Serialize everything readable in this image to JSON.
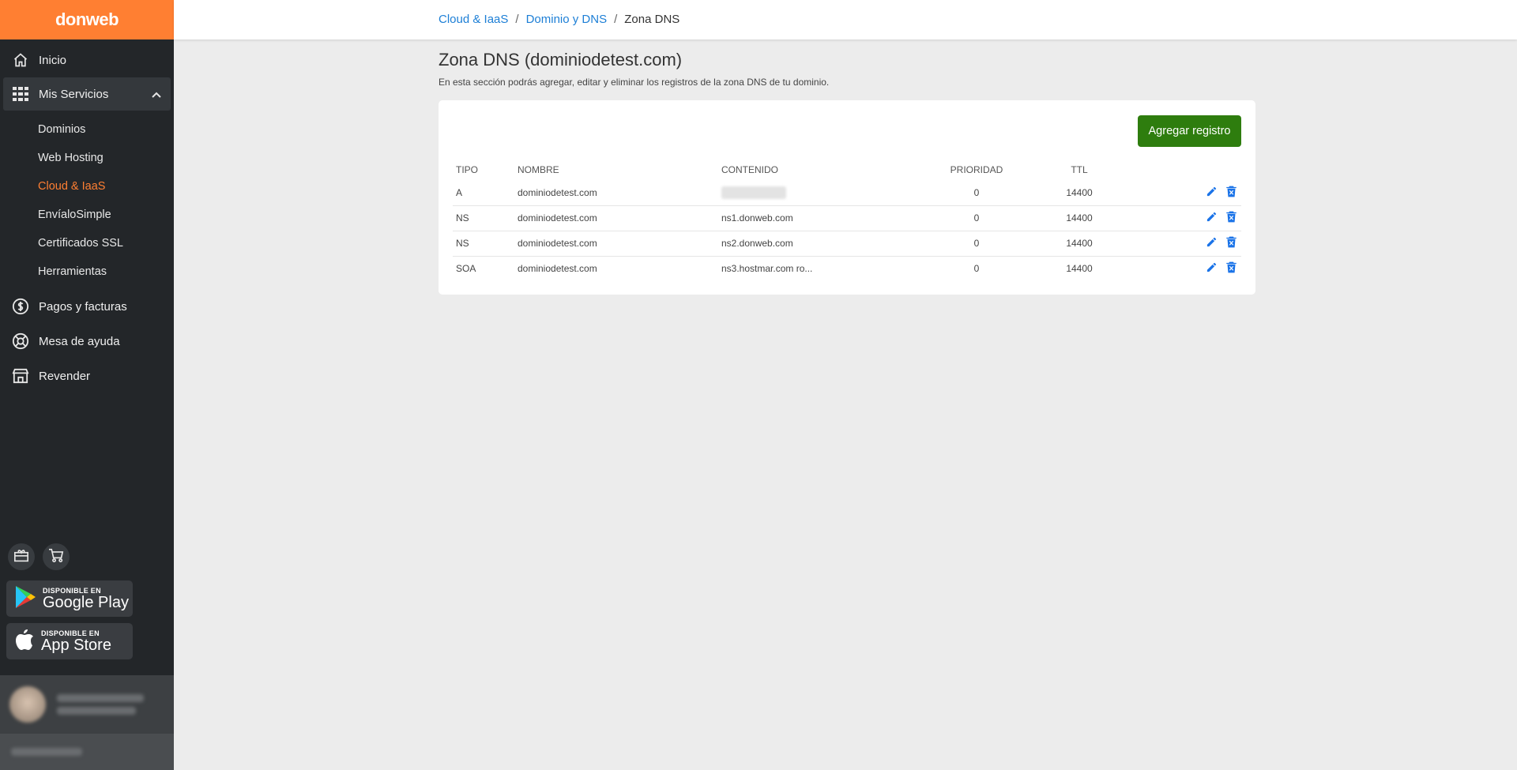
{
  "app": {
    "logo": "donweb"
  },
  "sidebar": {
    "top_items": [
      {
        "label": "Inicio",
        "icon": "home-icon"
      }
    ],
    "services": {
      "label": "Mis Servicios",
      "icon": "grid-icon",
      "items": [
        {
          "label": "Dominios"
        },
        {
          "label": "Web Hosting"
        },
        {
          "label": "Cloud & IaaS"
        },
        {
          "label": "EnvíaloSimple"
        },
        {
          "label": "Certificados SSL"
        },
        {
          "label": "Herramientas"
        }
      ]
    },
    "bottom_items": [
      {
        "label": "Pagos y facturas",
        "icon": "dollar-icon"
      },
      {
        "label": "Mesa de ayuda",
        "icon": "lifebuoy-icon"
      },
      {
        "label": "Revender",
        "icon": "store-icon"
      }
    ],
    "stores": {
      "google": {
        "small": "DISPONIBLE EN",
        "big": "Google Play"
      },
      "apple": {
        "small": "DISPONIBLE EN",
        "big": "App Store"
      }
    }
  },
  "breadcrumb": {
    "items": [
      "Cloud & IaaS",
      "Dominio y DNS"
    ],
    "current": "Zona DNS",
    "separator": "/"
  },
  "page": {
    "title": "Zona DNS (dominiodetest.com)",
    "description": "En esta sección podrás agregar, editar y eliminar los registros de la zona DNS de tu dominio.",
    "add_button": "Agregar registro"
  },
  "table": {
    "headers": {
      "type": "TIPO",
      "name": "NOMBRE",
      "content": "CONTENIDO",
      "priority": "PRIORIDAD",
      "ttl": "TTL"
    },
    "rows": [
      {
        "type": "A",
        "name": "dominiodetest.com",
        "content": "",
        "priority": "0",
        "ttl": "14400"
      },
      {
        "type": "NS",
        "name": "dominiodetest.com",
        "content": "ns1.donweb.com",
        "priority": "0",
        "ttl": "14400"
      },
      {
        "type": "NS",
        "name": "dominiodetest.com",
        "content": "ns2.donweb.com",
        "priority": "0",
        "ttl": "14400"
      },
      {
        "type": "SOA",
        "name": "dominiodetest.com",
        "content": "ns3.hostmar.com ro...",
        "priority": "0",
        "ttl": "14400"
      }
    ]
  },
  "colors": {
    "brand_orange": "#ff7f32",
    "sidebar_bg": "#232629",
    "link_blue": "#1d7fd6",
    "primary_green": "#2e7d0e",
    "action_blue": "#1a73e8"
  }
}
